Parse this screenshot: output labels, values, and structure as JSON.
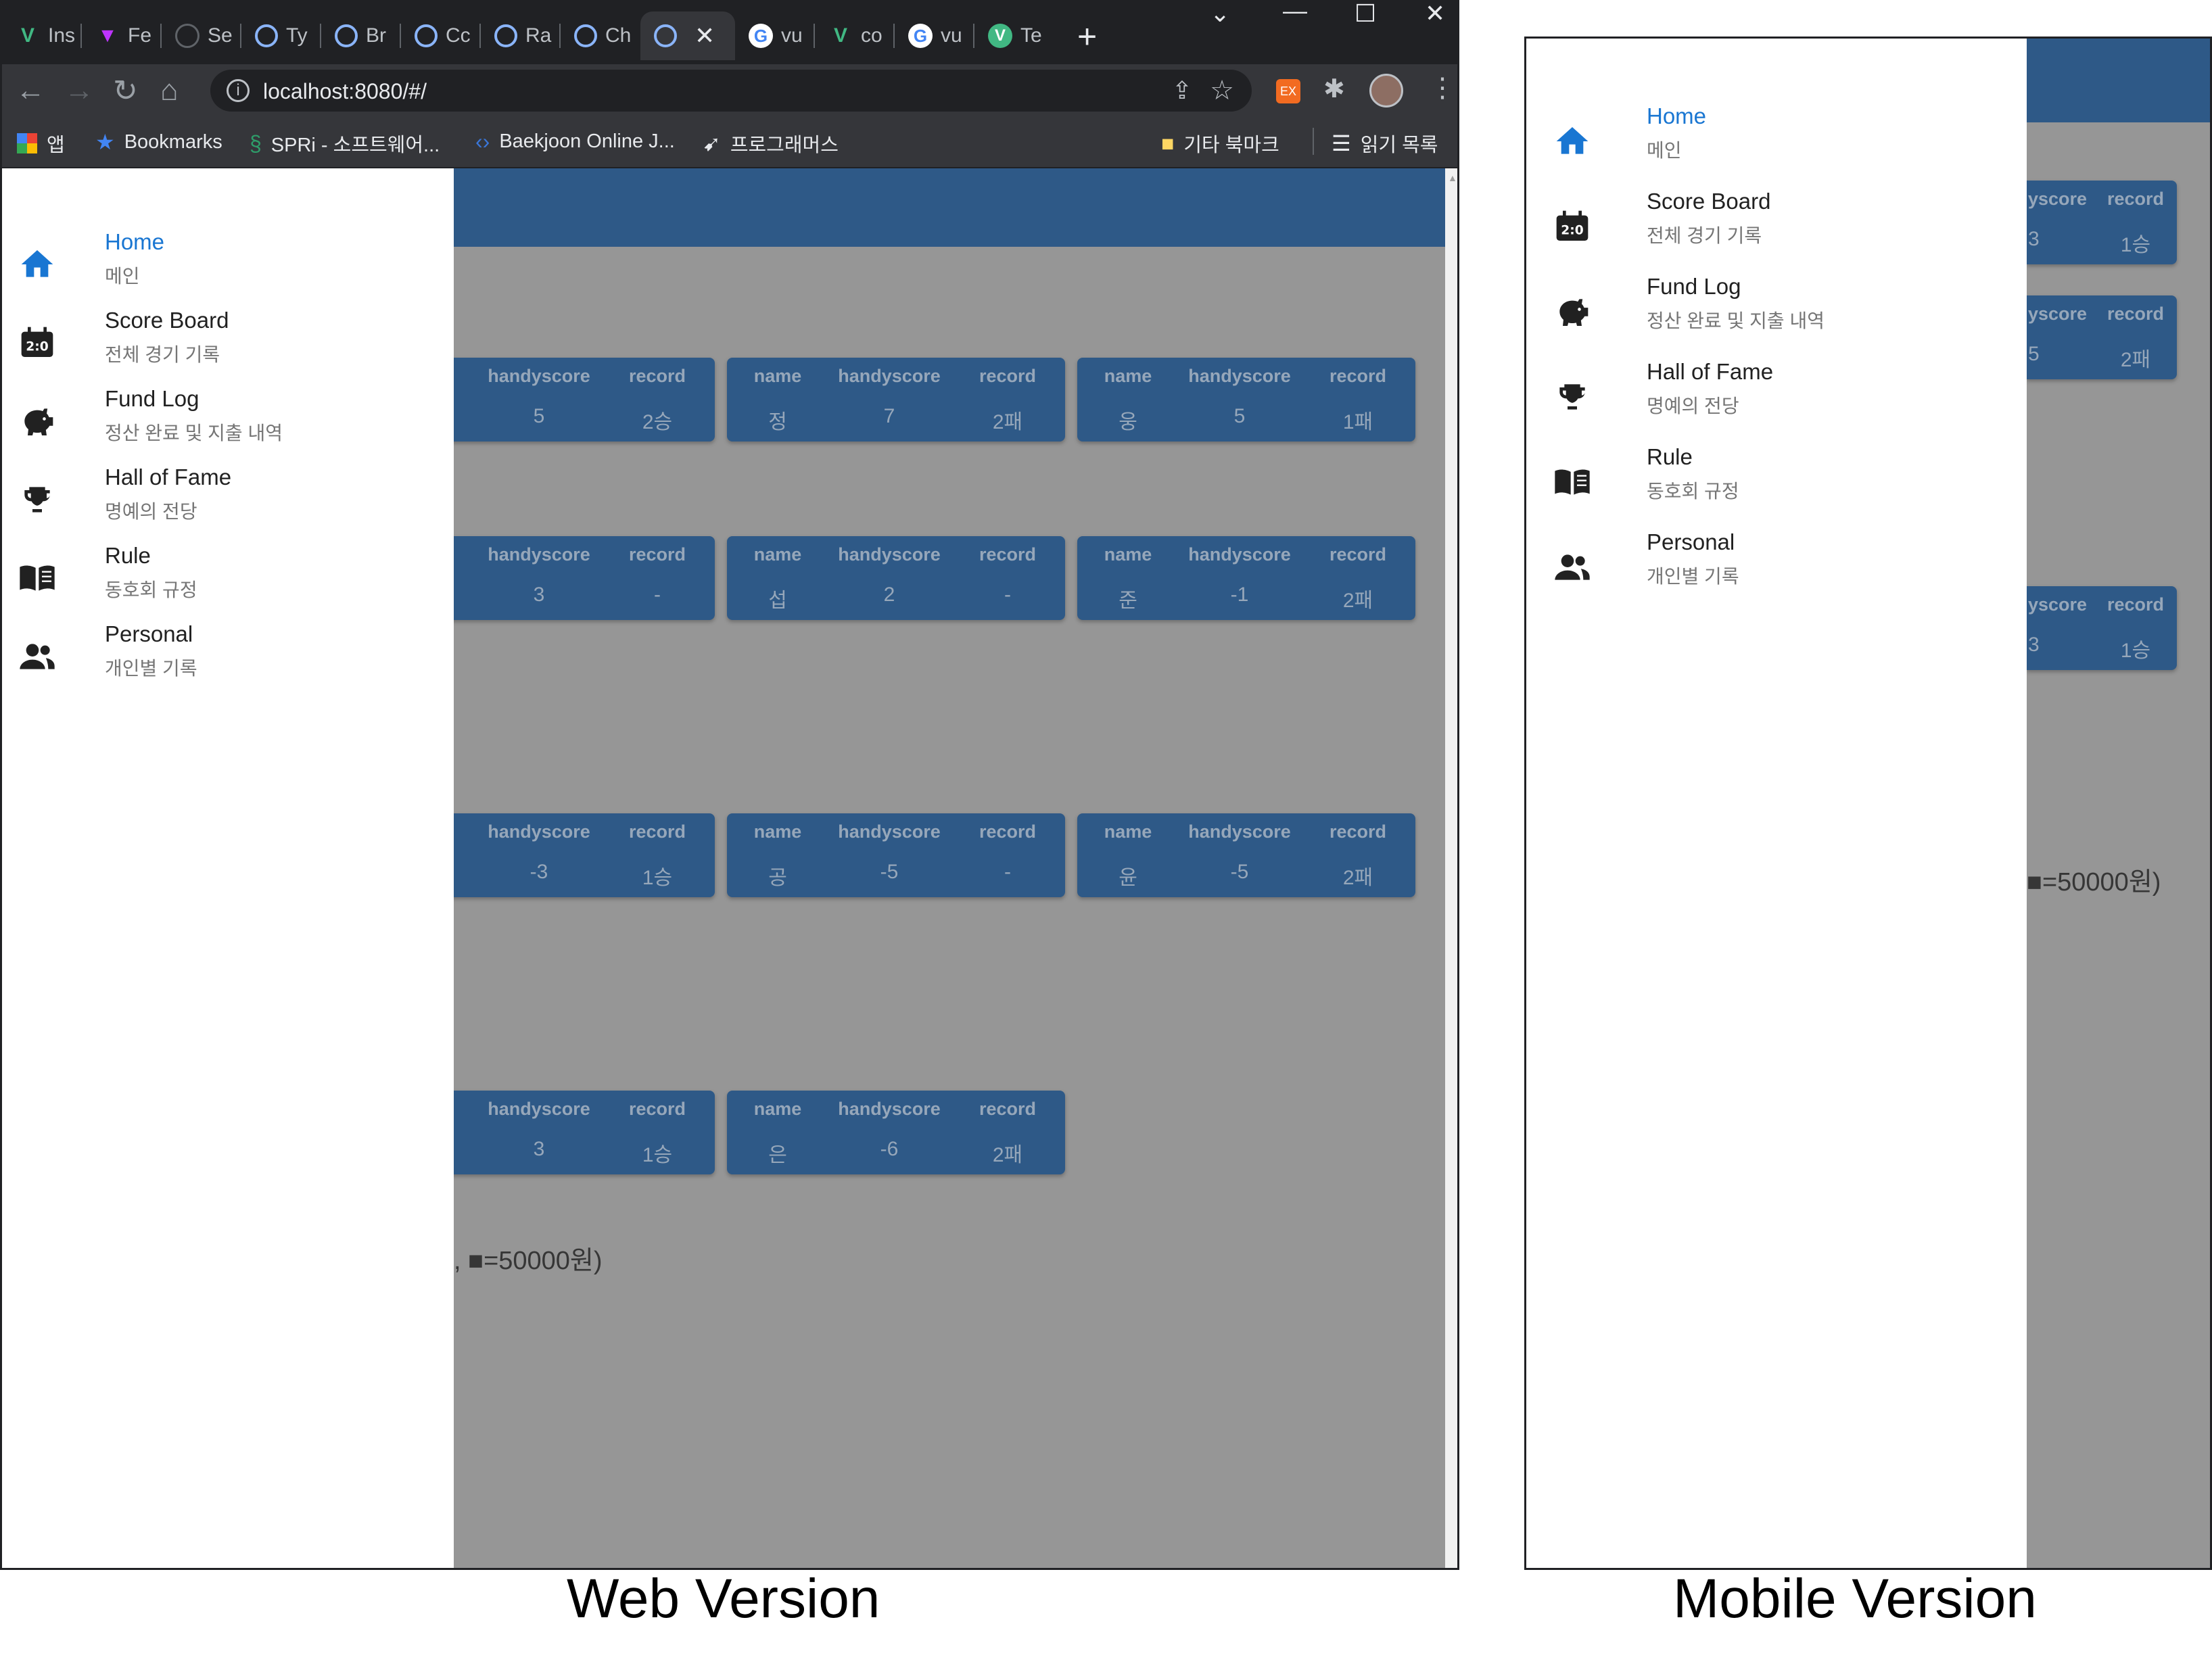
{
  "browser": {
    "tabs": [
      {
        "label": "Ins",
        "icon": "vue-icon"
      },
      {
        "label": "Fe",
        "icon": "vite-icon"
      },
      {
        "label": "Se",
        "icon": "github-icon"
      },
      {
        "label": "Ty",
        "icon": "sync-icon"
      },
      {
        "label": "Br",
        "icon": "sync-icon"
      },
      {
        "label": "Cc",
        "icon": "sync-icon"
      },
      {
        "label": "Ra",
        "icon": "sync-icon"
      },
      {
        "label": "Ch",
        "icon": "sync-icon"
      },
      {
        "label": "",
        "icon": "sync-icon"
      },
      {
        "label": "vu",
        "icon": "google-icon"
      },
      {
        "label": "co",
        "icon": "vue-icon"
      },
      {
        "label": "vu",
        "icon": "google-icon"
      },
      {
        "label": "Te",
        "icon": "vuetify-icon"
      }
    ],
    "url": "localhost:8080/#/",
    "bookmarks": {
      "apps": "앱",
      "bookmarks": "Bookmarks",
      "spri": "SPRi - 소프트웨어...",
      "baekjoon": "Baekjoon Online J...",
      "programmers": "프로그래머스",
      "other": "기타 북마크",
      "reading": "읽기 목록"
    }
  },
  "nav": {
    "items": [
      {
        "title": "Home",
        "subtitle": "메인",
        "icon": "home-icon",
        "active": true
      },
      {
        "title": "Score Board",
        "subtitle": "전체 경기 기록",
        "icon": "scoreboard-icon"
      },
      {
        "title": "Fund Log",
        "subtitle": "정산 완료 및 지출 내역",
        "icon": "piggy-bank-icon"
      },
      {
        "title": "Hall of Fame",
        "subtitle": "명예의 전당",
        "icon": "trophy-icon"
      },
      {
        "title": "Rule",
        "subtitle": "동호회 규정",
        "icon": "book-icon"
      },
      {
        "title": "Personal",
        "subtitle": "개인별 기록",
        "icon": "people-icon"
      }
    ]
  },
  "web_cards": {
    "r1": [
      {
        "h1": "handyscore",
        "h2": "record",
        "v1": "5",
        "v2": "2승"
      },
      {
        "h0": "name",
        "h1": "handyscore",
        "h2": "record",
        "v0": "정",
        "v1": "7",
        "v2": "2패"
      },
      {
        "h0": "name",
        "h1": "handyscore",
        "h2": "record",
        "v0": "웅",
        "v1": "5",
        "v2": "1패"
      }
    ],
    "r2": [
      {
        "h1": "handyscore",
        "h2": "record",
        "v1": "3",
        "v2": "-"
      },
      {
        "h0": "name",
        "h1": "handyscore",
        "h2": "record",
        "v0": "섭",
        "v1": "2",
        "v2": "-"
      },
      {
        "h0": "name",
        "h1": "handyscore",
        "h2": "record",
        "v0": "준",
        "v1": "-1",
        "v2": "2패"
      }
    ],
    "r3": [
      {
        "h1": "handyscore",
        "h2": "record",
        "v1": "-3",
        "v2": "1승"
      },
      {
        "h0": "name",
        "h1": "handyscore",
        "h2": "record",
        "v0": "공",
        "v1": "-5",
        "v2": "-"
      },
      {
        "h0": "name",
        "h1": "handyscore",
        "h2": "record",
        "v0": "윤",
        "v1": "-5",
        "v2": "2패"
      }
    ],
    "r4": [
      {
        "h1": "handyscore",
        "h2": "record",
        "v1": "3",
        "v2": "1승"
      },
      {
        "h0": "name",
        "h1": "handyscore",
        "h2": "record",
        "v0": "은",
        "v1": "-6",
        "v2": "2패"
      }
    ]
  },
  "web_note": ", ■=50000원)",
  "mobile_cards": [
    {
      "h1": "yscore",
      "h2": "record",
      "v1": "3",
      "v2": "1승"
    },
    {
      "h1": "yscore",
      "h2": "record",
      "v1": "5",
      "v2": "2패"
    },
    {
      "h1": "yscore",
      "h2": "record",
      "v1": "3",
      "v2": "1승"
    }
  ],
  "mobile_note": "■=50000원)",
  "captions": {
    "web": "Web Version",
    "mobile": "Mobile Version"
  },
  "colors": {
    "primary": "#0f4a8a",
    "active_nav": "#1976d2"
  }
}
